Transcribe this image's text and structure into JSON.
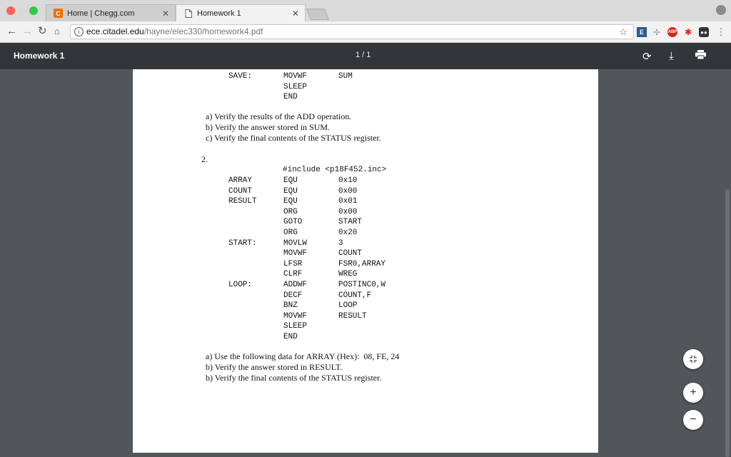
{
  "browser": {
    "tabs": [
      {
        "title": "Home | Chegg.com",
        "favicon": "C"
      },
      {
        "title": "Homework 1"
      }
    ],
    "address": {
      "host": "ece.citadel.edu",
      "path": "/hayne/elec330/homework4.pdf"
    },
    "extensions": [
      "E",
      "ABP"
    ]
  },
  "pdf_viewer": {
    "title": "Homework 1",
    "page_indicator": "1 / 1"
  },
  "document": {
    "top_code": [
      {
        "label": "SAVE:",
        "op": "MOVWF",
        "arg": "SUM"
      },
      {
        "label": "",
        "op": "SLEEP",
        "arg": ""
      },
      {
        "label": "",
        "op": "END",
        "arg": ""
      }
    ],
    "q1_items": [
      "a) Verify the results of the ADD operation.",
      "b) Verify the answer stored in SUM.",
      "c) Verify the final contents of the STATUS register."
    ],
    "q2_number": "2.",
    "q2_include": "#include <p18F452.inc>",
    "q2_code": [
      {
        "label": "ARRAY",
        "op": "EQU",
        "arg": "0x10"
      },
      {
        "label": "COUNT",
        "op": "EQU",
        "arg": "0x00"
      },
      {
        "label": "RESULT",
        "op": "EQU",
        "arg": "0x01"
      },
      {
        "label": "",
        "op": "ORG",
        "arg": "0x00"
      },
      {
        "label": "",
        "op": "GOTO",
        "arg": "START"
      },
      {
        "label": "",
        "op": "ORG",
        "arg": "0x20"
      },
      {
        "label": "START:",
        "op": "MOVLW",
        "arg": "3"
      },
      {
        "label": "",
        "op": "MOVWF",
        "arg": "COUNT"
      },
      {
        "label": "",
        "op": "LFSR",
        "arg": "FSR0,ARRAY"
      },
      {
        "label": "",
        "op": "CLRF",
        "arg": "WREG"
      },
      {
        "label": "LOOP:",
        "op": "ADDWF",
        "arg": "POSTINC0,W"
      },
      {
        "label": "",
        "op": "DECF",
        "arg": "COUNT,F"
      },
      {
        "label": "",
        "op": "BNZ",
        "arg": "LOOP"
      },
      {
        "label": "",
        "op": "MOVWF",
        "arg": "RESULT"
      },
      {
        "label": "",
        "op": "SLEEP",
        "arg": ""
      },
      {
        "label": "",
        "op": "END",
        "arg": ""
      }
    ],
    "q2_items": [
      "a) Use the following data for ARRAY (Hex):  08, FE, 24",
      "b) Verify the answer stored in RESULT.",
      "b) Verify the final contents of the STATUS register."
    ]
  },
  "zoom_controls": {
    "plus": "+",
    "minus": "−"
  }
}
